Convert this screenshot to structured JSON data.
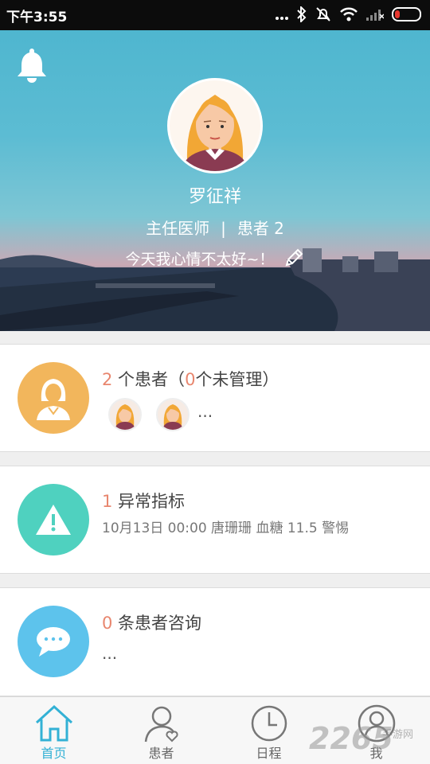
{
  "status_bar": {
    "time": "下午3:55"
  },
  "profile": {
    "name": "罗征祥",
    "title": "主任医师",
    "separator": "|",
    "patients_label": "患者 2",
    "mood": "今天我心情不太好~！"
  },
  "cards": {
    "patients": {
      "count": "2",
      "text": " 个患者（",
      "unmanaged": "0",
      "suffix": "个未管理）",
      "more": "..."
    },
    "alerts": {
      "count": "1",
      "text": " 异常指标",
      "detail": "10月13日 00:00 唐珊珊 血糖 11.5 警惕"
    },
    "consult": {
      "count": "0",
      "text": " 条患者咨询",
      "more": "..."
    }
  },
  "tabs": [
    {
      "label": "首页",
      "icon": "home-icon",
      "active": true
    },
    {
      "label": "患者",
      "icon": "patient-icon",
      "active": false
    },
    {
      "label": "日程",
      "icon": "clock-icon",
      "active": false
    },
    {
      "label": "我",
      "icon": "user-icon",
      "active": false
    }
  ],
  "watermark": {
    "main": "2265",
    "sub": "手游网"
  },
  "colors": {
    "accent": "#33b1d5",
    "orange": "#f2b65c",
    "teal": "#4fd1bf",
    "blue": "#5dc3ec",
    "number": "#e8866e"
  }
}
